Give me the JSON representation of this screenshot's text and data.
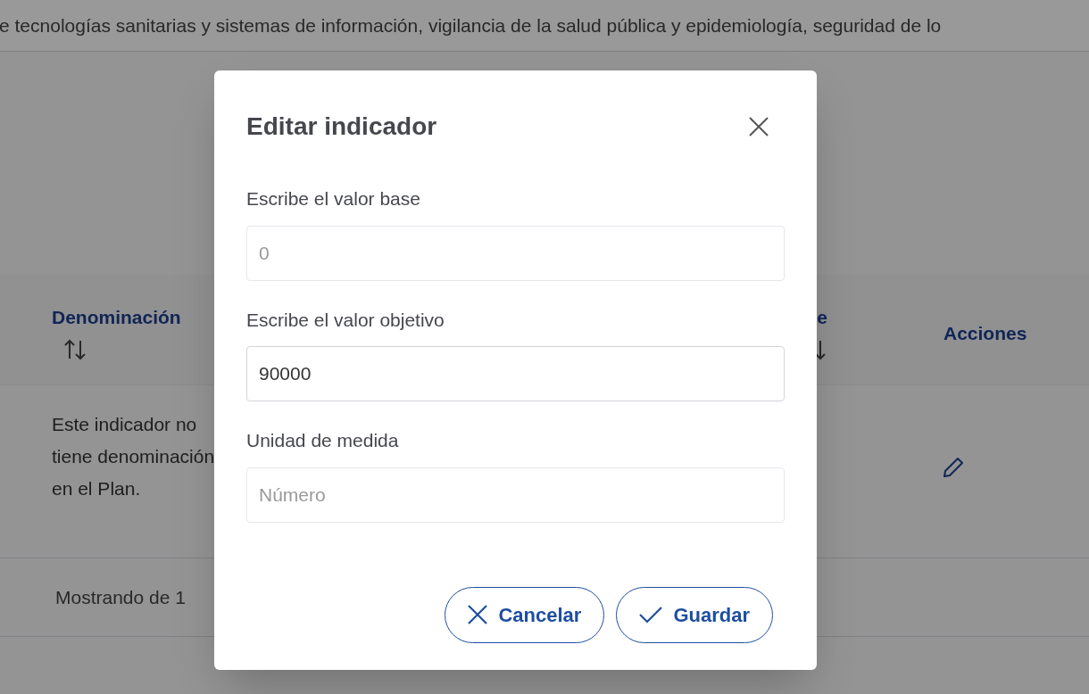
{
  "page": {
    "intro_text": "e tecnologías sanitarias y sistemas de información, vigilancia de la salud pública y epidemiología, seguridad de lo"
  },
  "table": {
    "columns": [
      {
        "label": "Denominación",
        "sortable": true
      },
      {
        "label": "e",
        "sortable": true
      },
      {
        "label": "Acciones",
        "sortable": false
      }
    ],
    "rows": [
      {
        "denominacion": "Este indicador no tiene denominación en el Plan."
      }
    ],
    "footer": "Mostrando de 1"
  },
  "dialog": {
    "title": "Editar indicador",
    "fields": [
      {
        "label": "Escribe el valor base",
        "placeholder": "0"
      },
      {
        "label": "Escribe el valor objetivo",
        "value": "90000"
      },
      {
        "label": "Unidad de medida",
        "placeholder": "Número"
      }
    ],
    "buttons": [
      {
        "kind": "cancel",
        "label": "Cancelar"
      },
      {
        "kind": "save",
        "label": "Guardar"
      }
    ]
  }
}
